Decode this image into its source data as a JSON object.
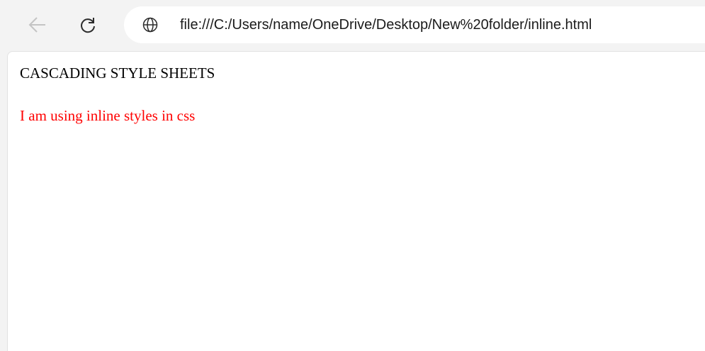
{
  "browser": {
    "url": "file:///C:/Users/name/OneDrive/Desktop/New%20folder/inline.html",
    "back_icon": "arrow-left-icon",
    "reload_icon": "reload-icon",
    "site_icon": "globe-icon"
  },
  "page": {
    "heading": "CASCADING STYLE SHEETS",
    "paragraph": "I am using inline styles in css",
    "paragraph_color": "#ff0000"
  }
}
